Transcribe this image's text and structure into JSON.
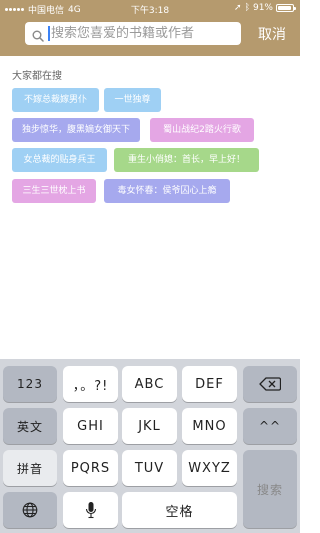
{
  "status": {
    "carrier": "中国电信",
    "network": "4G",
    "time": "下午3:18",
    "battery": "91%"
  },
  "header": {
    "search_placeholder": "搜索您喜爱的书籍或作者",
    "cancel_label": "取消"
  },
  "hot": {
    "title": "大家都在搜",
    "tags": [
      {
        "label": "不嫁总裁嫁男仆",
        "color": "#9fd0f4"
      },
      {
        "label": "一世独尊",
        "color": "#9fd0f4"
      },
      {
        "label": "独步惊华，腹黑嫡女御天下",
        "color": "#a6a9ee"
      },
      {
        "label": "蜀山战纪2踏火行歌",
        "color": "#e4a6e4"
      },
      {
        "label": "女总裁的贴身兵王",
        "color": "#9fd0f4"
      },
      {
        "label": "重生小俏媳：首长，早上好！",
        "color": "#a6d88a"
      },
      {
        "label": "三生三世枕上书",
        "color": "#e4a6e4"
      },
      {
        "label": "毒女怀春：侯爷囚心上瘾",
        "color": "#a6a9ee"
      }
    ]
  },
  "keyboard": {
    "k123": "123",
    "punct": "，。?!",
    "abc": "ABC",
    "def": "DEF",
    "english": "英文",
    "ghi": "GHI",
    "jkl": "JKL",
    "mno": "MNO",
    "emoticon": "^^",
    "pinyin": "拼音",
    "pqrs": "PQRS",
    "tuv": "TUV",
    "wxyz": "WXYZ",
    "search": "搜索",
    "space": "空格"
  }
}
